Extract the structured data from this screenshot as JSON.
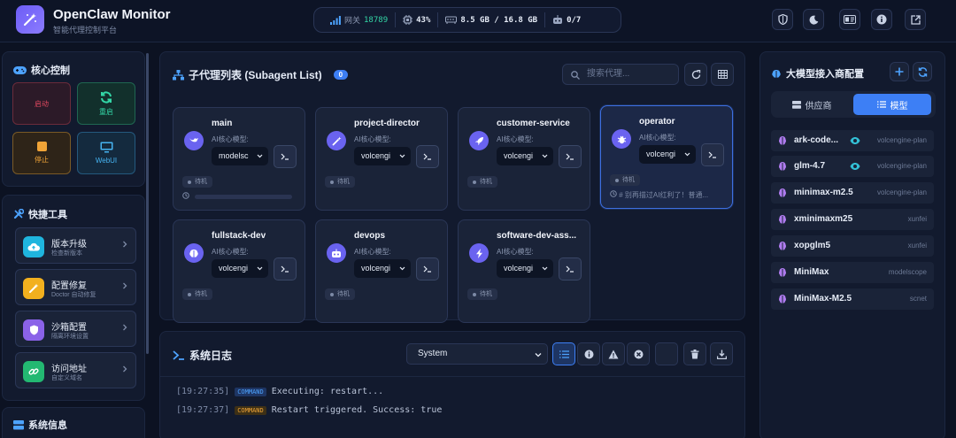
{
  "header": {
    "title": "OpenClaw Monitor",
    "subtitle": "智能代理控制平台",
    "stats": {
      "gateway_label": "网关",
      "gateway_port": "18789",
      "cpu": "43%",
      "memory": "8.5 GB / 16.8 GB",
      "agents": "0/7"
    }
  },
  "sidebar": {
    "core_title": "核心控制",
    "controls": [
      "启动",
      "重启",
      "停止",
      "WebUI"
    ],
    "tools_title": "快捷工具",
    "tools": [
      {
        "title": "版本升级",
        "sub": "检查新版本"
      },
      {
        "title": "配置修复",
        "sub": "Doctor 自动修复"
      },
      {
        "title": "沙箱配置",
        "sub": "隔离环境设置"
      },
      {
        "title": "访问地址",
        "sub": "自定义域名"
      }
    ],
    "sysinfo_title": "系统信息"
  },
  "subagents": {
    "title": "子代理列表 (Subagent List)",
    "count": "0",
    "search_placeholder": "搜索代理...",
    "model_label": "AI核心模型:",
    "cards": [
      {
        "name": "main",
        "model": "modelsc",
        "status": "待机",
        "footer": ""
      },
      {
        "name": "project-director",
        "model": "volcengi",
        "status": "待机",
        "footer": ""
      },
      {
        "name": "customer-service",
        "model": "volcengi",
        "status": "待机",
        "footer": ""
      },
      {
        "name": "operator",
        "model": "volcengi",
        "status": "待机",
        "footer": "# 别再描过AI红利了！普通..."
      },
      {
        "name": "fullstack-dev",
        "model": "volcengi",
        "status": "待机",
        "footer": ""
      },
      {
        "name": "devops",
        "model": "volcengi",
        "status": "待机",
        "footer": ""
      },
      {
        "name": "software-dev-ass...",
        "model": "volcengi",
        "status": "待机",
        "footer": ""
      }
    ]
  },
  "logs": {
    "title": "系统日志",
    "filter": "System",
    "lines": [
      {
        "time": "[19:27:35]",
        "tag": "COMMAND",
        "text": "Executing: restart..."
      },
      {
        "time": "[19:27:37]",
        "tag": "COMMAND",
        "text": "Restart triggered. Success: true"
      }
    ]
  },
  "llm": {
    "title": "大模型接入商配置",
    "tab_provider": "供应商",
    "tab_model": "模型",
    "providers": [
      {
        "name": "ark-code...",
        "vendor": "volcengine-plan"
      },
      {
        "name": "glm-4.7",
        "vendor": "volcengine-plan"
      },
      {
        "name": "minimax-m2.5",
        "vendor": "volcengine-plan"
      },
      {
        "name": "xminimaxm25",
        "vendor": "xunfei"
      },
      {
        "name": "xopglm5",
        "vendor": "xunfei"
      },
      {
        "name": "MiniMax",
        "vendor": "modelscope"
      },
      {
        "name": "MiniMax-M2.5",
        "vendor": "scnet"
      }
    ]
  },
  "colors": {
    "accent": "#3d7ff5",
    "bg": "#0c1222",
    "panel": "#121a2e",
    "gateway": "#33d6a6"
  }
}
